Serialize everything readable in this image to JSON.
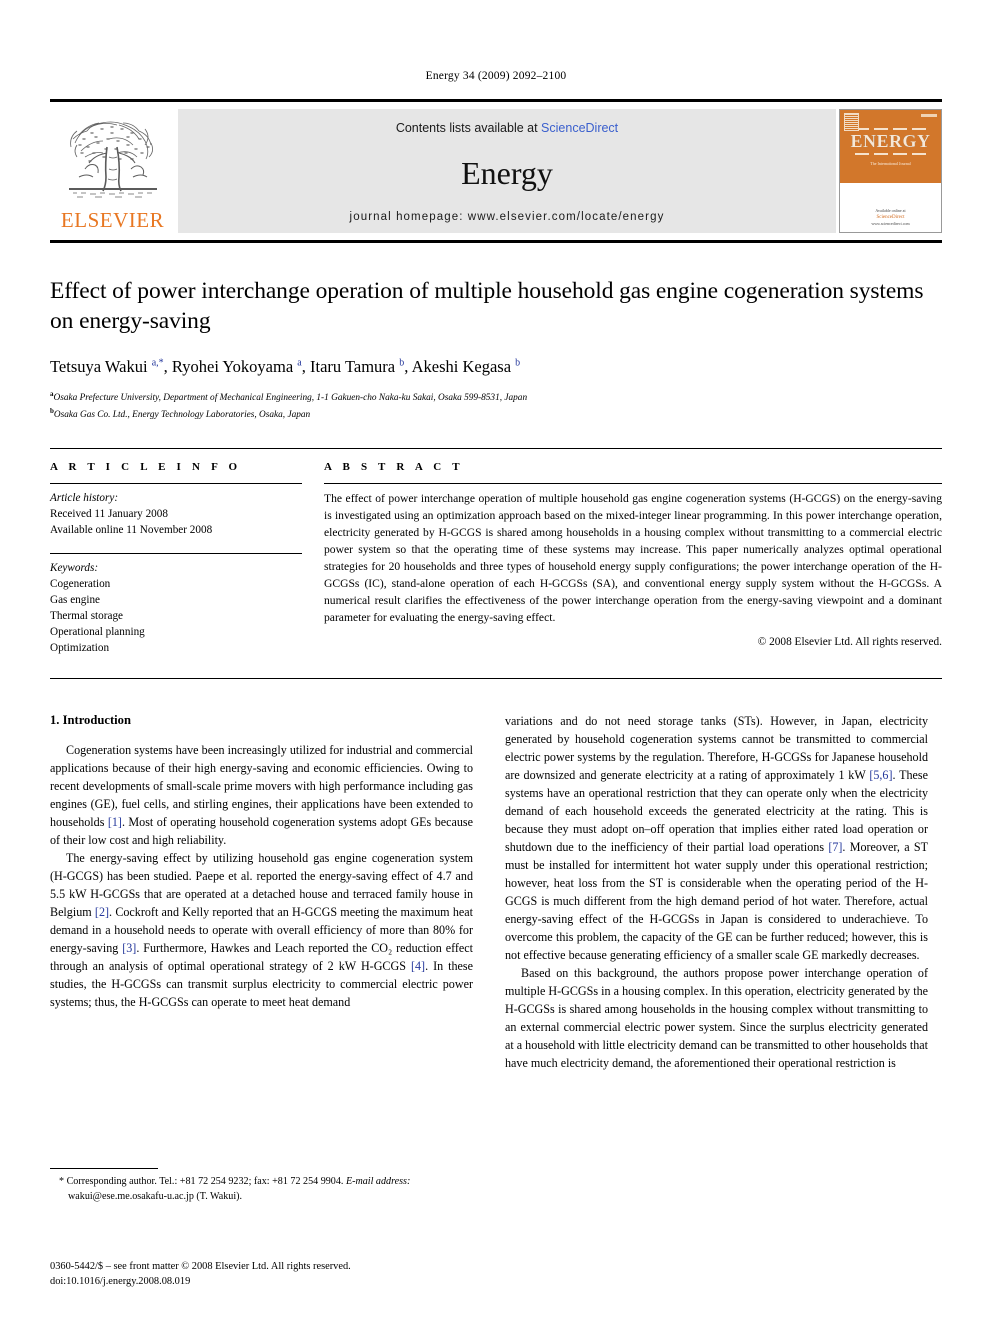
{
  "running_head": "Energy 34 (2009) 2092–2100",
  "masthead": {
    "publisher_name": "ELSEVIER",
    "publisher_logo_icon": "elsevier-tree-icon",
    "contents_prefix": "Contents lists available at ",
    "contents_link": "ScienceDirect",
    "journal_name": "Energy",
    "homepage_line": "journal homepage: www.elsevier.com/locate/energy",
    "cover": {
      "title": "ENERGY",
      "subtitle": "The International Journal",
      "footer_prefix": "Available online at",
      "footer_brand": "ScienceDirect",
      "footer_url": "www.sciencedirect.com"
    },
    "accent_orange": "#E87722",
    "link_blue": "#3a5fcd",
    "band_gray": "#e6e6e6"
  },
  "article": {
    "title": "Effect of power interchange operation of multiple household gas engine cogeneration systems on energy-saving",
    "authors": [
      {
        "name": "Tetsuya Wakui",
        "marks": "a,*"
      },
      {
        "name": "Ryohei Yokoyama",
        "marks": "a"
      },
      {
        "name": "Itaru Tamura",
        "marks": "b"
      },
      {
        "name": "Akeshi Kegasa",
        "marks": "b"
      }
    ],
    "affiliations": [
      {
        "mark": "a",
        "text": "Osaka Prefecture University, Department of Mechanical Engineering, 1-1 Gakuen-cho Naka-ku Sakai, Osaka 599-8531, Japan"
      },
      {
        "mark": "b",
        "text": "Osaka Gas Co. Ltd., Energy Technology Laboratories, Osaka, Japan"
      }
    ]
  },
  "article_info": {
    "heading": "A R T I C L E  I N F O",
    "history_label": "Article history:",
    "history": [
      "Received 11 January 2008",
      "Available online 11 November 2008"
    ],
    "keywords_label": "Keywords:",
    "keywords": [
      "Cogeneration",
      "Gas engine",
      "Thermal storage",
      "Operational planning",
      "Optimization"
    ]
  },
  "abstract": {
    "heading": "A B S T R A C T",
    "text": "The effect of power interchange operation of multiple household gas engine cogeneration systems (H-GCGS) on the energy-saving is investigated using an optimization approach based on the mixed-integer linear programming. In this power interchange operation, electricity generated by H-GCGS is shared among households in a housing complex without transmitting to a commercial electric power system so that the operating time of these systems may increase. This paper numerically analyzes optimal operational strategies for 20 households and three types of household energy supply configurations; the power interchange operation of the H-GCGSs (IC), stand-alone operation of each H-GCGSs (SA), and conventional energy supply system without the H-GCGSs. A numerical result clarifies the effectiveness of the power interchange operation from the energy-saving viewpoint and a dominant parameter for evaluating the energy-saving effect.",
    "copyright": "© 2008 Elsevier Ltd. All rights reserved."
  },
  "introduction": {
    "section_number_title": "1. Introduction",
    "left_paragraphs": [
      {
        "segments": [
          {
            "t": "Cogeneration systems have been increasingly utilized for industrial and commercial applications because of their high energy-saving and economic efficiencies. Owing to recent developments of small-scale prime movers with high performance including gas engines (GE), fuel cells, and stirling engines, their applications have been extended to households "
          },
          {
            "t": "[1]",
            "ref": true
          },
          {
            "t": ". Most of operating household cogeneration systems adopt GEs because of their low cost and high reliability."
          }
        ]
      },
      {
        "segments": [
          {
            "t": "The energy-saving effect by utilizing household gas engine cogeneration system (H-GCGS) has been studied. Paepe et al. reported the energy-saving effect of 4.7 and 5.5 kW H-GCGSs that are operated at a detached house and terraced family house in Belgium "
          },
          {
            "t": "[2]",
            "ref": true
          },
          {
            "t": ". Cockroft and Kelly reported that an H-GCGS meeting the maximum heat demand in a household needs to operate with overall efficiency of more than 80% for energy-saving "
          },
          {
            "t": "[3]",
            "ref": true
          },
          {
            "t": ". Furthermore, Hawkes and Leach reported the CO₂ reduction effect through an analysis of optimal operational strategy of 2 kW H-GCGS "
          },
          {
            "t": "[4]",
            "ref": true
          },
          {
            "t": ". In these studies, the H-GCGSs can transmit surplus electricity to commercial electric power systems; thus, the H-GCGSs can operate to meet heat demand"
          }
        ]
      }
    ],
    "right_paragraphs": [
      {
        "segments": [
          {
            "t": "variations and do not need storage tanks (STs). However, in Japan, electricity generated by household cogeneration systems cannot be transmitted to commercial electric power systems by the regulation. Therefore, H-GCGSs for Japanese household are downsized and generate electricity at a rating of approximately 1 kW "
          },
          {
            "t": "[5,6]",
            "ref": true
          },
          {
            "t": ". These systems have an operational restriction that they can operate only when the electricity demand of each household exceeds the generated electricity at the rating. This is because they must adopt on–off operation that implies either rated load operation or shutdown due to the inefficiency of their partial load operations "
          },
          {
            "t": "[7]",
            "ref": true
          },
          {
            "t": ". Moreover, a ST must be installed for intermittent hot water supply under this operational restriction; however, heat loss from the ST is considerable when the operating period of the H-GCGS is much different from the high demand period of hot water. Therefore, actual energy-saving effect of the H-GCGSs in Japan is considered to underachieve. To overcome this problem, the capacity of the GE can be further reduced; however, this is not effective because generating efficiency of a smaller scale GE markedly decreases."
          }
        ]
      },
      {
        "segments": [
          {
            "t": "Based on this background, the authors propose power interchange operation of multiple H-GCGSs in a housing complex. In this operation, electricity generated by the H-GCGSs is shared among households in the housing complex without transmitting to an external commercial electric power system. Since the surplus electricity generated at a household with little electricity demand can be transmitted to other households that have much electricity demand, the aforementioned their operational restriction is"
          }
        ]
      }
    ]
  },
  "footnote": {
    "star": "*",
    "corresponding_text": "Corresponding author. Tel.: +81 72 254 9232; fax: +81 72 254 9904.",
    "email_label": "E-mail address:",
    "email": "wakui@ese.me.osakafu-u.ac.jp",
    "email_owner": "(T. Wakui)."
  },
  "page_footer": {
    "issn_line": "0360-5442/$ – see front matter © 2008 Elsevier Ltd. All rights reserved.",
    "doi_line": "doi:10.1016/j.energy.2008.08.019"
  }
}
